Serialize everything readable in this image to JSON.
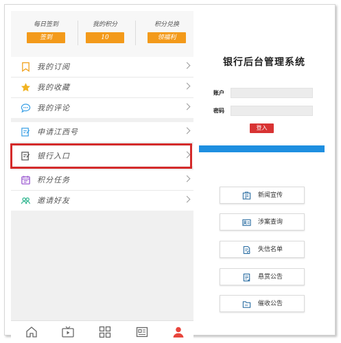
{
  "stats": [
    {
      "label": "每日签到",
      "button": "签到"
    },
    {
      "label": "我的积分",
      "button": "10"
    },
    {
      "label": "积分兑换",
      "button": "领福利"
    }
  ],
  "menu": [
    {
      "label": "我的订阅",
      "icon": "bookmark-icon"
    },
    {
      "label": "我的收藏",
      "icon": "star-icon"
    },
    {
      "label": "我的评论",
      "icon": "comment-icon"
    },
    {
      "label": "申请江西号",
      "icon": "edit-icon"
    },
    {
      "label": "银行入口",
      "icon": "bank-entry-icon"
    },
    {
      "label": "积分任务",
      "icon": "calendar-icon"
    },
    {
      "label": "邀请好友",
      "icon": "friends-icon"
    }
  ],
  "tabbar": [
    "home-icon",
    "video-icon",
    "grid-icon",
    "news-icon",
    "profile-icon"
  ],
  "admin": {
    "title": "银行后台管理系统",
    "account_label": "账户",
    "password_label": "密码",
    "account_value": "",
    "password_value": "",
    "login": "登入",
    "buttons": [
      {
        "label": "新闻宣传",
        "icon": "news-icon"
      },
      {
        "label": "涉案查询",
        "icon": "id-card-icon"
      },
      {
        "label": "失信名单",
        "icon": "document-icon"
      },
      {
        "label": "悬赏公告",
        "icon": "list-icon"
      },
      {
        "label": "催收公告",
        "icon": "folder-icon"
      }
    ]
  },
  "colors": {
    "orange": "#f39a1a",
    "highlight_red": "#d42a2a",
    "login_red": "#d83333",
    "blue_bar": "#1e8fe0",
    "profile_active": "#e8453c"
  }
}
